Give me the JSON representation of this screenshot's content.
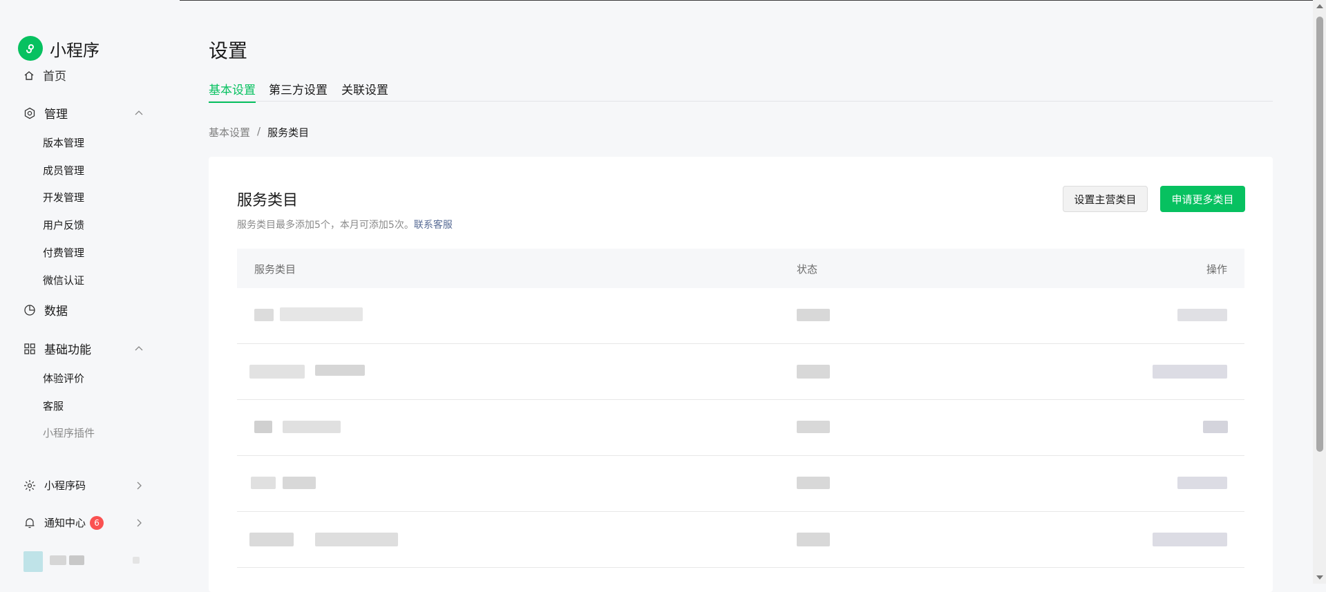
{
  "app": {
    "name": "小程序"
  },
  "sidebar": {
    "home_label": "首页",
    "groups": [
      {
        "label": "管理",
        "icon": "hexagon-settings-icon",
        "items": [
          "版本管理",
          "成员管理",
          "开发管理",
          "用户反馈",
          "付费管理",
          "微信认证"
        ]
      },
      {
        "label": "数据",
        "icon": "pie-chart-icon"
      },
      {
        "label": "基础功能",
        "icon": "grid-apps-icon",
        "items": [
          "体验评价",
          "客服",
          "小程序插件"
        ]
      },
      {
        "label": "小程序码",
        "icon": "sun-burst-icon"
      },
      {
        "label": "通知中心",
        "icon": "bell-icon",
        "badge": "6"
      }
    ]
  },
  "page": {
    "title": "设置",
    "tabs": [
      "基本设置",
      "第三方设置",
      "关联设置"
    ],
    "breadcrumb": {
      "parent": "基本设置",
      "separator": "/",
      "current": "服务类目"
    }
  },
  "card": {
    "title": "服务类目",
    "description": "服务类目最多添加5个，本月可添加5次。",
    "contact_link": "联系客服",
    "buttons": {
      "set_main": "设置主营类目",
      "apply_more": "申请更多类目"
    }
  },
  "table": {
    "columns": [
      "服务类目",
      "状态",
      "操作"
    ]
  },
  "colors": {
    "brand": "#07c160",
    "link": "#576b95",
    "badge": "#fa5151"
  }
}
